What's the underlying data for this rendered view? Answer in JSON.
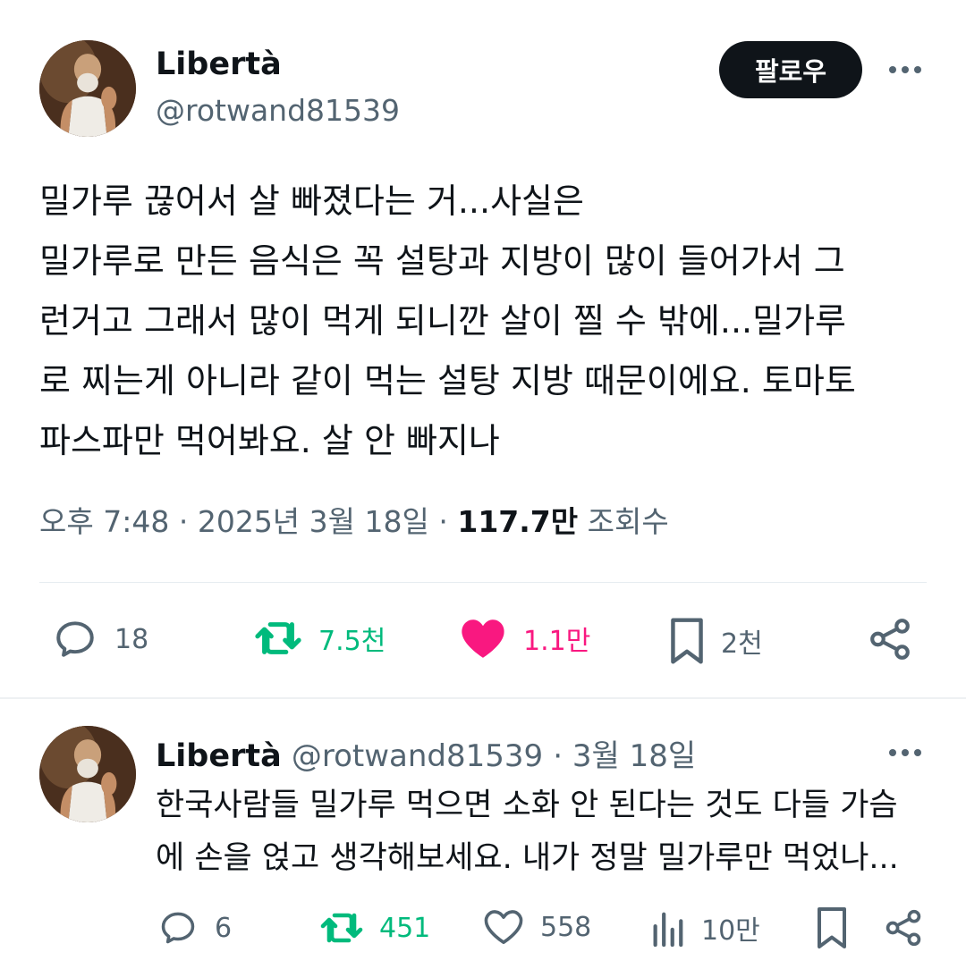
{
  "tweet": {
    "author": {
      "display_name": "Libertà",
      "handle": "@rotwand81539"
    },
    "follow_label": "팔로우",
    "text_lines": [
      "밀가루 끊어서 살 빠졌다는 거...사실은",
      "밀가루로 만든 음식은 꼭 설탕과 지방이 많이 들어가서 그",
      "런거고 그래서 많이 먹게 되니깐 살이 찔 수 밖에...밀가루",
      "로 찌는게 아니라 같이 먹는 설탕 지방 때문이에요. 토마토",
      "파스파만 먹어봐요. 살 안 빠지나"
    ],
    "time": "오후 7:48",
    "date": "2025년 3월 18일",
    "separator": "·",
    "views_count": "117.7만",
    "views_label": "조회수",
    "actions": {
      "replies": "18",
      "retweets": "7.5천",
      "likes": "1.1만",
      "bookmarks": "2천"
    },
    "colors": {
      "retweet": "#00ba7c",
      "like": "#f91880"
    }
  },
  "reply": {
    "display_name": "Libertà",
    "handle": "@rotwand81539",
    "date": "· 3월 18일",
    "text_lines": [
      "한국사람들 밀가루 먹으면 소화 안 된다는 것도 다들 가슴",
      "에 손을 얹고 생각해보세요. 내가 정말 밀가루만 먹었나..."
    ],
    "actions": {
      "replies": "6",
      "retweets": "451",
      "likes": "558",
      "views": "10만"
    }
  }
}
